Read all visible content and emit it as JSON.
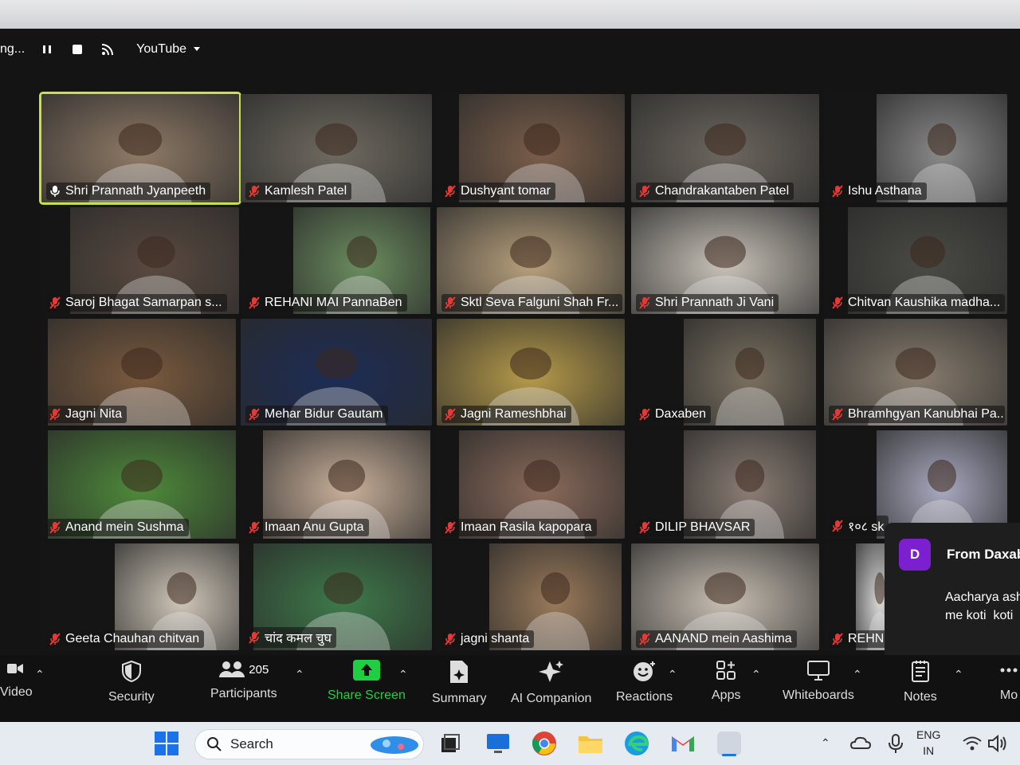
{
  "live_bar": {
    "status": "ng...",
    "stream_target": "YouTube"
  },
  "participants": [
    {
      "name": "Shri Prannath Jyanpeeth",
      "muted": false,
      "active": true
    },
    {
      "name": "Kamlesh Patel",
      "muted": true
    },
    {
      "name": "Dushyant tomar",
      "muted": true
    },
    {
      "name": "Chandrakantaben Patel",
      "muted": true
    },
    {
      "name": "Ishu Asthana",
      "muted": true
    },
    {
      "name": "Saroj Bhagat Samarpan s...",
      "muted": true
    },
    {
      "name": "REHANI MAI PannaBen",
      "muted": true
    },
    {
      "name": "Sktl Seva Falguni Shah Fr...",
      "muted": true
    },
    {
      "name": "Shri Prannath Ji Vani",
      "muted": true
    },
    {
      "name": "Chitvan Kaushika madha...",
      "muted": true
    },
    {
      "name": "Jagni Nita",
      "muted": true
    },
    {
      "name": "Mehar Bidur Gautam",
      "muted": true
    },
    {
      "name": "Jagni  Rameshbhai",
      "muted": true
    },
    {
      "name": "Daxaben",
      "muted": true
    },
    {
      "name": "Bhramhgyan Kanubhai Pa...",
      "muted": true
    },
    {
      "name": "Anand mein Sushma",
      "muted": true
    },
    {
      "name": "Imaan Anu Gupta",
      "muted": true
    },
    {
      "name": "Imaan Rasila  kapopara",
      "muted": true
    },
    {
      "name": "DILIP BHAVSAR",
      "muted": true
    },
    {
      "name": "१०८ sk",
      "muted": true
    },
    {
      "name": "Geeta Chauhan  chitvan",
      "muted": true
    },
    {
      "name": "चांद कमल चुघ",
      "muted": true
    },
    {
      "name": "jagni shanta",
      "muted": true
    },
    {
      "name": "AANAND mein Aashima",
      "muted": true
    },
    {
      "name": "REHNI",
      "muted": true
    }
  ],
  "chat_toast": {
    "avatar_letter": "D",
    "from": "From Daxab",
    "message": "Aacharya ash\nme koti  koti"
  },
  "toolbar": {
    "video": "Video",
    "security": "Security",
    "participants": "Participants",
    "participants_count": "205",
    "share_screen": "Share Screen",
    "summary": "Summary",
    "ai_companion": "AI Companion",
    "reactions": "Reactions",
    "apps": "Apps",
    "whiteboards": "Whiteboards",
    "notes": "Notes",
    "more": "Mo"
  },
  "taskbar": {
    "search_placeholder": "Search",
    "lang_top": "ENG",
    "lang_bottom": "IN"
  },
  "colors": {
    "active_speaker": "#c8e04a",
    "share_green": "#1fcf41",
    "chat_avatar": "#7b1fd1",
    "muted_red": "#e53935"
  }
}
